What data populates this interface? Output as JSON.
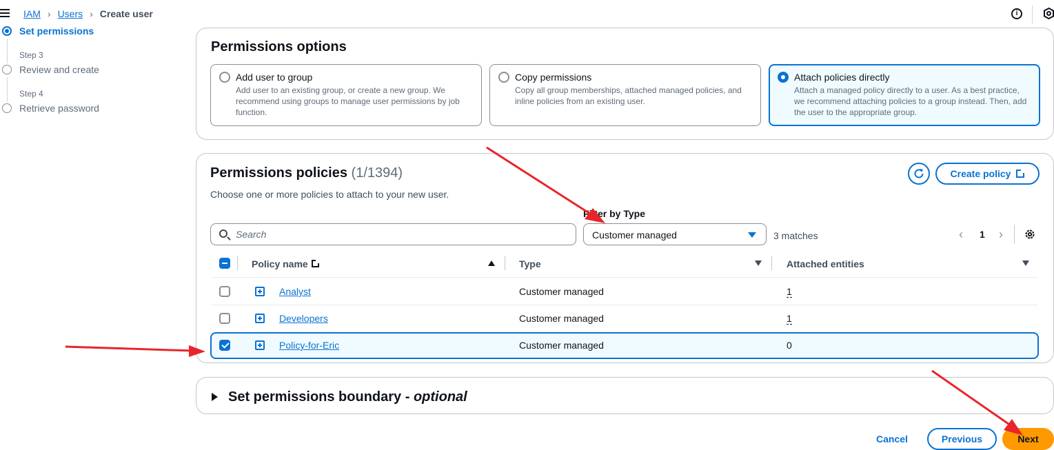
{
  "breadcrumb": [
    "IAM",
    "Users",
    "Create user"
  ],
  "steps": [
    {
      "step": "",
      "label": "Set permissions",
      "active": true
    },
    {
      "step": "Step 3",
      "label": "Review and create",
      "active": false
    },
    {
      "step": "Step 4",
      "label": "Retrieve password",
      "active": false
    }
  ],
  "permissions_options": {
    "title": "Permissions options",
    "tiles": [
      {
        "title": "Add user to group",
        "desc": "Add user to an existing group, or create a new group. We recommend using groups to manage user permissions by job function.",
        "selected": false
      },
      {
        "title": "Copy permissions",
        "desc": "Copy all group memberships, attached managed policies, and inline policies from an existing user.",
        "selected": false
      },
      {
        "title": "Attach policies directly",
        "desc": "Attach a managed policy directly to a user. As a best practice, we recommend attaching policies to a group instead. Then, add the user to the appropriate group.",
        "selected": true
      }
    ]
  },
  "policies": {
    "title": "Permissions policies",
    "count": "(1/1394)",
    "subtitle": "Choose one or more policies to attach to your new user.",
    "create_policy_label": "Create policy",
    "filter_label": "Filter by Type",
    "search_placeholder": "Search",
    "filter_value": "Customer managed",
    "matches": "3 matches",
    "page": "1",
    "columns": [
      "Policy name",
      "Type",
      "Attached entities"
    ],
    "rows": [
      {
        "name": "Analyst",
        "type": "Customer managed",
        "entities": "1",
        "checked": false
      },
      {
        "name": "Developers",
        "type": "Customer managed",
        "entities": "1",
        "checked": false
      },
      {
        "name": "Policy-for-Eric",
        "type": "Customer managed",
        "entities": "0",
        "checked": true
      }
    ]
  },
  "boundary": {
    "title": "Set permissions boundary - ",
    "optional": "optional"
  },
  "footer": {
    "cancel": "Cancel",
    "previous": "Previous",
    "next": "Next"
  },
  "colors": {
    "accent": "#0972d3",
    "primary_button": "#ff9900",
    "annotation_arrow": "#e8252b"
  }
}
